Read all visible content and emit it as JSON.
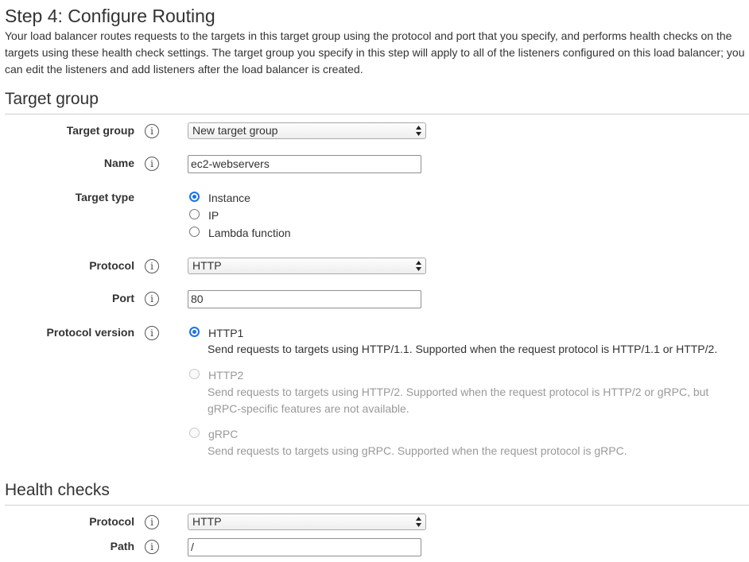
{
  "step_title": "Step 4: Configure Routing",
  "intro": "Your load balancer routes requests to the targets in this target group using the protocol and port that you specify, and performs health checks on the targets using these health check settings. The target group you specify in this step will apply to all of the listeners configured on this load balancer; you can edit the listeners and add listeners after the load balancer is created.",
  "info_glyph": "i",
  "target_group_section": {
    "title": "Target group",
    "target_group": {
      "label": "Target group",
      "value": "New target group"
    },
    "name": {
      "label": "Name",
      "value": "ec2-webservers"
    },
    "target_type": {
      "label": "Target type",
      "options": [
        {
          "label": "Instance",
          "checked": true
        },
        {
          "label": "IP",
          "checked": false
        },
        {
          "label": "Lambda function",
          "checked": false
        }
      ]
    },
    "protocol": {
      "label": "Protocol",
      "value": "HTTP"
    },
    "port": {
      "label": "Port",
      "value": "80"
    },
    "protocol_version": {
      "label": "Protocol version",
      "options": [
        {
          "label": "HTTP1",
          "description": "Send requests to targets using HTTP/1.1. Supported when the request protocol is HTTP/1.1 or HTTP/2.",
          "checked": true,
          "disabled": false
        },
        {
          "label": "HTTP2",
          "description": "Send requests to targets using HTTP/2. Supported when the request protocol is HTTP/2 or gRPC, but gRPC-specific features are not available.",
          "checked": false,
          "disabled": true
        },
        {
          "label": "gRPC",
          "description": "Send requests to targets using gRPC. Supported when the request protocol is gRPC.",
          "checked": false,
          "disabled": true
        }
      ]
    }
  },
  "health_checks_section": {
    "title": "Health checks",
    "protocol": {
      "label": "Protocol",
      "value": "HTTP"
    },
    "path": {
      "label": "Path",
      "value": "/"
    }
  },
  "colors": {
    "accent": "#1a73e8",
    "rule": "#cfcfcf",
    "disabled_text": "#999999"
  }
}
